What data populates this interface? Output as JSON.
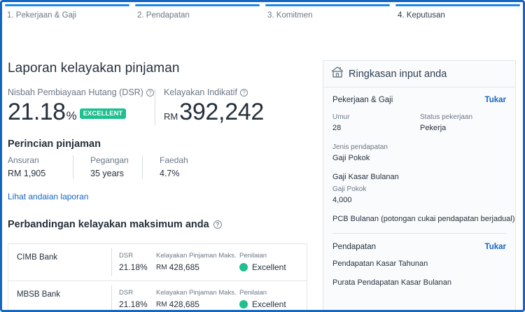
{
  "steps": [
    {
      "label": "1. Pekerjaan & Gaji"
    },
    {
      "label": "2. Pendapatan"
    },
    {
      "label": "3. Komitmen"
    },
    {
      "label": "4. Keputusan"
    }
  ],
  "report": {
    "title": "Laporan kelayakan pinjaman",
    "dsr_label": "Nisbah Pembiayaan Hutang (DSR)",
    "dsr_value": "21.18",
    "dsr_unit": "%",
    "dsr_badge": "EXCELLENT",
    "eligibility_label": "Kelayakan Indikatif",
    "eligibility_currency": "RM",
    "eligibility_value": "392,242",
    "breakdown_title": "Perincian pinjaman",
    "breakdown": [
      {
        "label": "Ansuran",
        "value": "RM 1,905"
      },
      {
        "label": "Pegangan",
        "value": "35 years"
      },
      {
        "label": "Faedah",
        "value": "4.7%"
      }
    ],
    "view_link": "Lihat andaian laporan",
    "compare_title": "Perbandingan kelayakan maksimum anda",
    "compare_columns": {
      "dsr": "DSR",
      "max": "Kelayakan Pinjaman Maks.",
      "rating": "Penilaian"
    },
    "banks": [
      {
        "name": "CIMB Bank",
        "dsr": "21.18%",
        "currency": "RM",
        "max": "428,685",
        "rating": "Excellent"
      },
      {
        "name": "MBSB Bank",
        "dsr": "21.18%",
        "currency": "RM",
        "max": "428,685",
        "rating": "Excellent"
      }
    ]
  },
  "summary": {
    "title": "Ringkasan input anda",
    "job_section": {
      "title": "Pekerjaan & Gaji",
      "edit": "Tukar",
      "age_label": "Umur",
      "age_value": "28",
      "job_status_label": "Status pekerjaan",
      "job_status_value": "Pekerja",
      "income_type_label": "Jenis pendapatan",
      "income_type_value": "Gaji Pokok",
      "gross_monthly_label": "Gaji Kasar Bulanan",
      "basic_salary_label": "Gaji Pokok",
      "basic_salary_value": "4,000",
      "pcb_label": "PCB Bulanan (potongan cukai pendapatan berjadual)"
    },
    "income_section": {
      "title": "Pendapatan",
      "edit": "Tukar",
      "annual_gross_label": "Pendapatan Kasar Tahunan",
      "avg_monthly_label": "Purata Pendapatan Kasar Bulanan"
    }
  },
  "colors": {
    "accent": "#1565c0",
    "progress": "#1e88e5",
    "excellent": "#1fbf8f"
  }
}
